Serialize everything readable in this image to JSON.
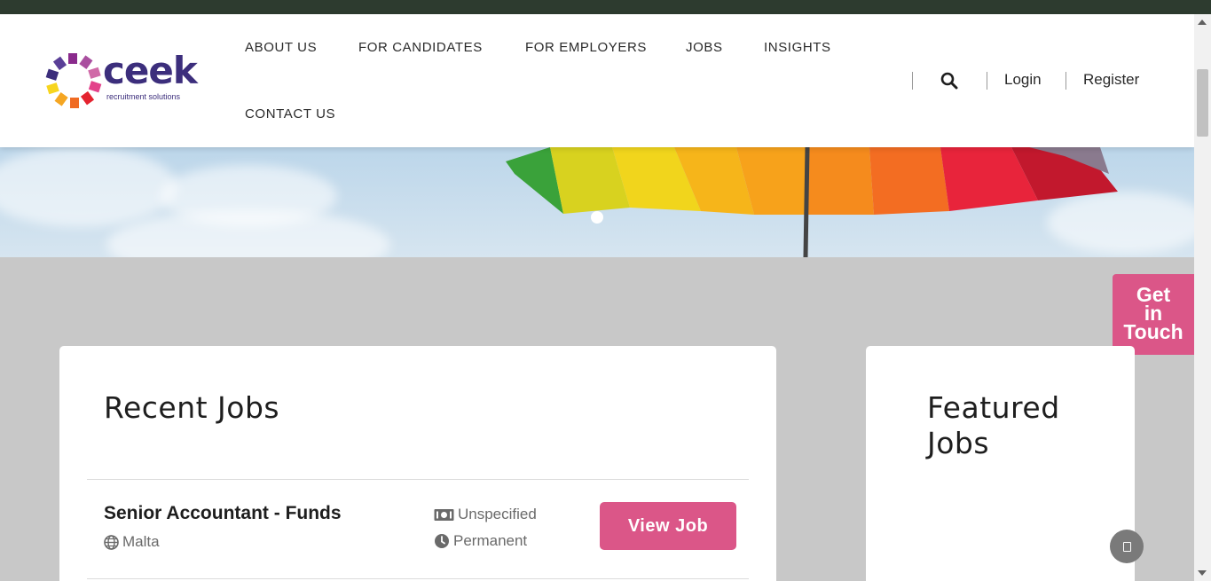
{
  "colors": {
    "accent": "#db5688",
    "brand": "#3c2e7c",
    "browser_bar": "#2d3b2f"
  },
  "logo": {
    "word": "ceek",
    "tagline": "recruitment solutions",
    "icon": "ceek-logo-icon"
  },
  "nav": {
    "items": [
      {
        "label": "ABOUT US"
      },
      {
        "label": "FOR CANDIDATES"
      },
      {
        "label": "FOR EMPLOYERS"
      },
      {
        "label": "JOBS"
      },
      {
        "label": "INSIGHTS"
      },
      {
        "label": "CONTACT US"
      }
    ],
    "search_icon": "search-icon",
    "login": "Login",
    "register": "Register"
  },
  "hero": {
    "image": "rainbow-umbrella",
    "slides": 1,
    "active_slide": 1
  },
  "get_in_touch": {
    "line1": "Get",
    "line2": "in",
    "line3": "Touch"
  },
  "recent_jobs": {
    "title": "Recent Jobs",
    "jobs": [
      {
        "title": "Senior Accountant - Funds",
        "location": "Malta",
        "salary": "Unspecified",
        "type": "Permanent",
        "button": "View Job"
      }
    ]
  },
  "featured_jobs": {
    "title_line1": "Featured",
    "title_line2": "Jobs"
  },
  "chat": {
    "icon": "chat-icon"
  }
}
